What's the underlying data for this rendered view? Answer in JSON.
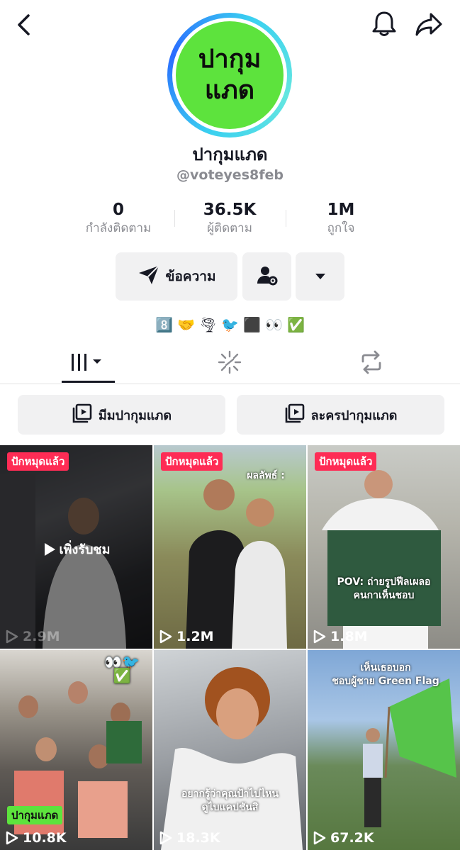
{
  "header": {
    "back_icon": "chevron-left-icon",
    "bell_icon": "bell-icon",
    "share_icon": "share-icon"
  },
  "profile": {
    "avatar_text": "ปากุม\nแภด",
    "avatar_color": "#5de33d",
    "display_name": "ปากุมแภด",
    "handle": "@voteyes8feb"
  },
  "stats": [
    {
      "value": "0",
      "label": "กำลังติดตาม"
    },
    {
      "value": "36.5K",
      "label": "ผู้ติดตาม"
    },
    {
      "value": "1M",
      "label": "ถูกใจ"
    }
  ],
  "actions": {
    "message_label": "ข้อความ",
    "message_icon": "send-icon",
    "follow_settings_icon": "user-gear-icon",
    "more_icon": "caret-down-icon"
  },
  "bio_emojis": [
    "8️⃣",
    "🤝",
    "🌪",
    "🐦",
    "⬛",
    "👀",
    "✅"
  ],
  "tabs": [
    {
      "name": "videos",
      "icon": "grid-bars-icon",
      "active": true
    },
    {
      "name": "reposts-sparkle",
      "icon": "sparkle-icon",
      "active": false
    },
    {
      "name": "repost",
      "icon": "repost-icon",
      "active": false
    }
  ],
  "playlists": [
    {
      "label": "มีมปากุมแภด",
      "icon": "playlist-icon"
    },
    {
      "label": "ละครปากุมแภด",
      "icon": "playlist-icon"
    }
  ],
  "videos": [
    {
      "badge": "ปักหมุดแล้ว",
      "views": "2.9M",
      "overlay": "เพิ่งรับชม",
      "caption": ""
    },
    {
      "badge": "ปักหมุดแล้ว",
      "views": "1.2M",
      "overlay": "",
      "caption": "ผลลัพธ์ :"
    },
    {
      "badge": "ปักหมุดแล้ว",
      "views": "1.8M",
      "overlay": "",
      "caption": "POV: ถ่ายรูปฟีลเผลอ\nคนกาเห็นชอบ"
    },
    {
      "badge": "ปากุมแภด",
      "views": "10.8K",
      "overlay": "",
      "caption": ""
    },
    {
      "badge": "",
      "views": "18.3K",
      "overlay": "",
      "caption": "อยากรู้ว่าคุณป้าไปไหน\nดูไบแคปชันสิ"
    },
    {
      "badge": "",
      "views": "67.2K",
      "overlay": "",
      "caption": "เห็นเธอบอก\nชอบผู้ชาย Green Flag"
    }
  ],
  "colors": {
    "pinned_badge": "#fe2c55",
    "green_badge": "#5de33d",
    "button_bg": "#f1f1f2",
    "muted_text": "#8a8b91"
  }
}
